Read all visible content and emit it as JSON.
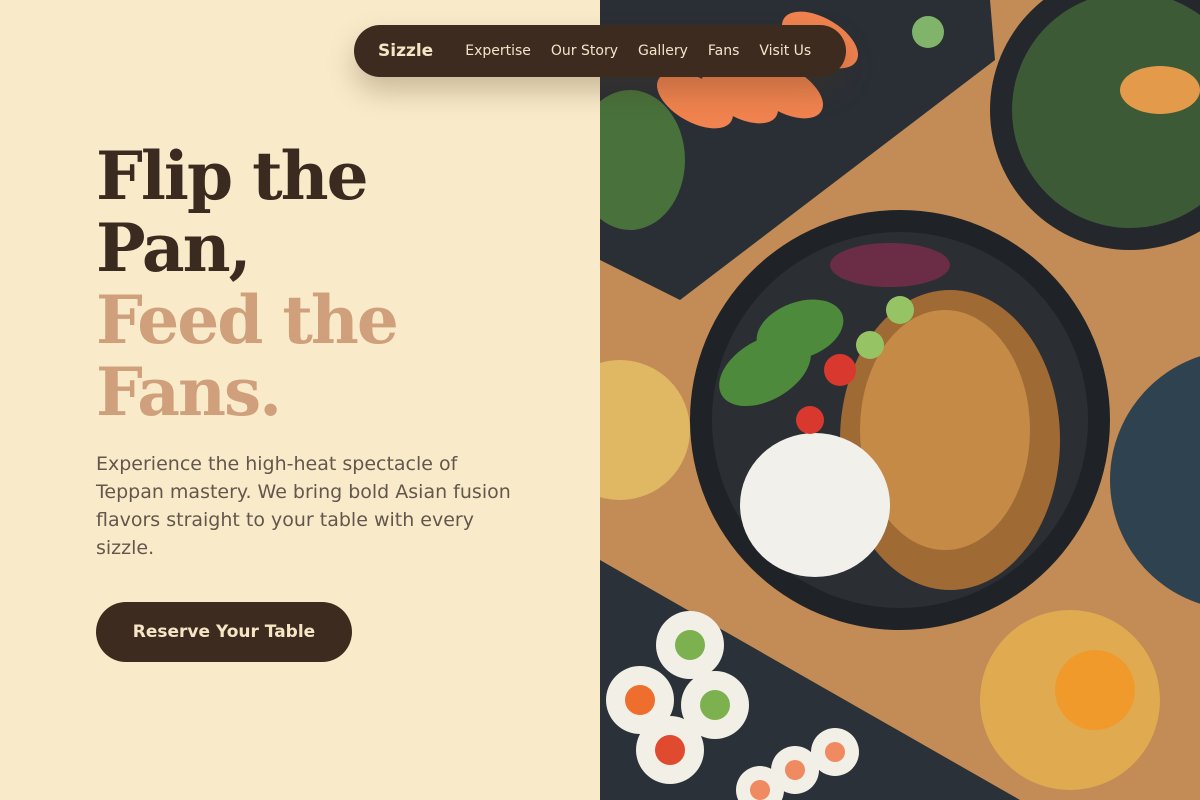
{
  "nav": {
    "brand": "Sizzle",
    "links": [
      {
        "label": "Expertise"
      },
      {
        "label": "Our Story"
      },
      {
        "label": "Gallery"
      },
      {
        "label": "Fans"
      },
      {
        "label": "Visit Us"
      }
    ]
  },
  "hero": {
    "title_line1": "Flip the",
    "title_line2": "Pan,",
    "title_line3": "Feed the",
    "title_line4": "Fans.",
    "description": "Experience the high-heat spectacle of Teppan mastery. We bring bold Asian fusion flavors straight to your table with every sizzle.",
    "cta_label": "Reserve Your Table"
  },
  "colors": {
    "background": "#f9ebca",
    "dark_brown": "#3d2b20",
    "accent": "#cfa07b",
    "body_text": "#63574d"
  }
}
